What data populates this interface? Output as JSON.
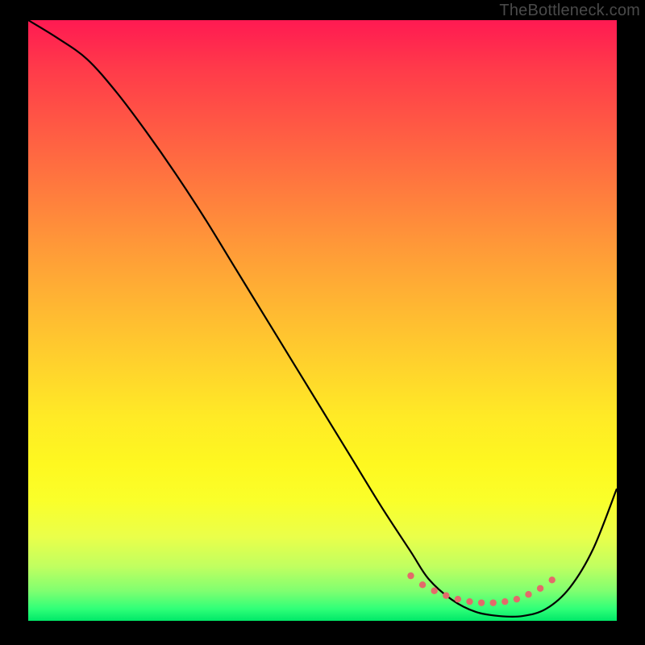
{
  "watermark": "TheBottleneck.com",
  "chart_data": {
    "type": "line",
    "title": "",
    "xlabel": "",
    "ylabel": "",
    "xlim": [
      0,
      100
    ],
    "ylim": [
      0,
      100
    ],
    "grid": false,
    "legend": false,
    "background_gradient": {
      "top": "#ff1a52",
      "middle": "#ffd42c",
      "bottom": "#00e868"
    },
    "series": [
      {
        "name": "bottleneck-curve",
        "color": "#000000",
        "x": [
          0,
          5,
          10,
          15,
          20,
          25,
          30,
          35,
          40,
          45,
          50,
          55,
          60,
          65,
          68,
          72,
          76,
          80,
          84,
          88,
          92,
          96,
          100
        ],
        "y": [
          100,
          97,
          93.5,
          88,
          81.5,
          74.5,
          67,
          59,
          51,
          43,
          35,
          27,
          19,
          11.5,
          7,
          3.5,
          1.5,
          0.8,
          0.8,
          2,
          5.5,
          12,
          22
        ]
      },
      {
        "name": "optimum-marker",
        "color": "#e36a6a",
        "style": "dotted",
        "x": [
          65,
          67,
          69,
          71,
          73,
          75,
          77,
          79,
          81,
          83,
          85,
          87,
          89
        ],
        "y": [
          7.5,
          6,
          5,
          4.2,
          3.6,
          3.2,
          3.0,
          3.0,
          3.2,
          3.6,
          4.4,
          5.4,
          6.8
        ]
      }
    ]
  }
}
